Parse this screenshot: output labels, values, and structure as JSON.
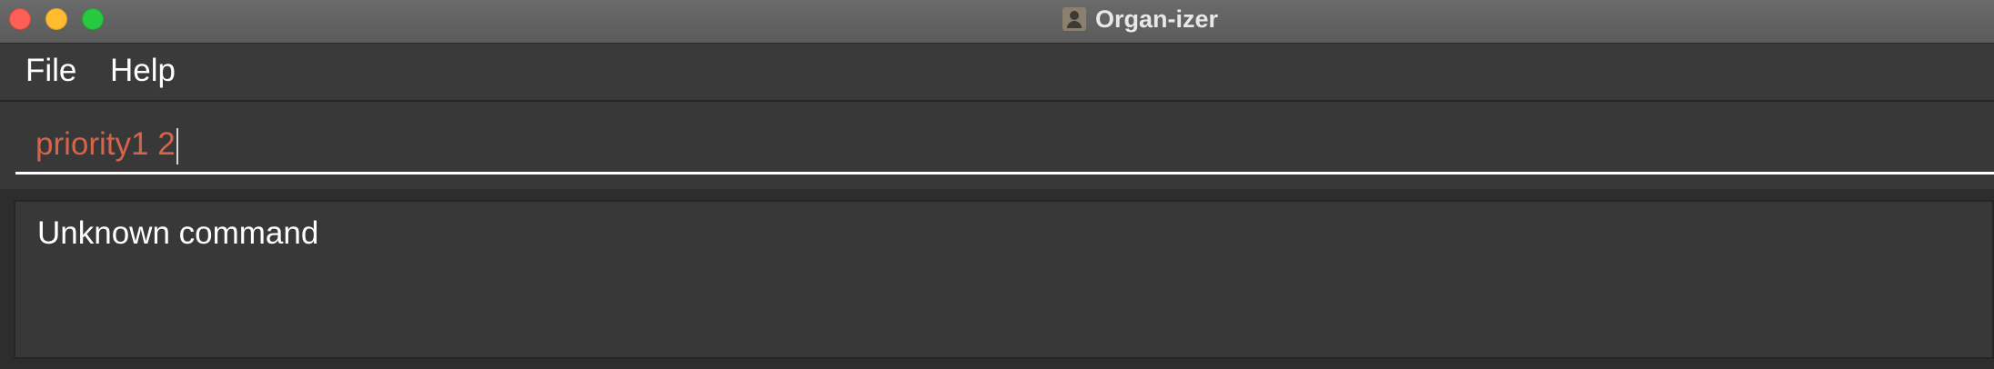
{
  "window": {
    "title": "Organ-izer",
    "controls": [
      "close",
      "minimize",
      "zoom"
    ],
    "app_icon": "contact-card-icon"
  },
  "menu": {
    "items": [
      {
        "label": "File"
      },
      {
        "label": "Help"
      }
    ]
  },
  "command_box": {
    "value": "priority1 2",
    "text_color": "#d6644a"
  },
  "result": {
    "message": "Unknown command"
  },
  "colors": {
    "title_bar": "#5f5f5f",
    "menu_bar": "#3a3a3a",
    "panel": "#383838",
    "close": "#fe5f57",
    "minimize": "#febc2e",
    "zoom": "#28c840"
  }
}
